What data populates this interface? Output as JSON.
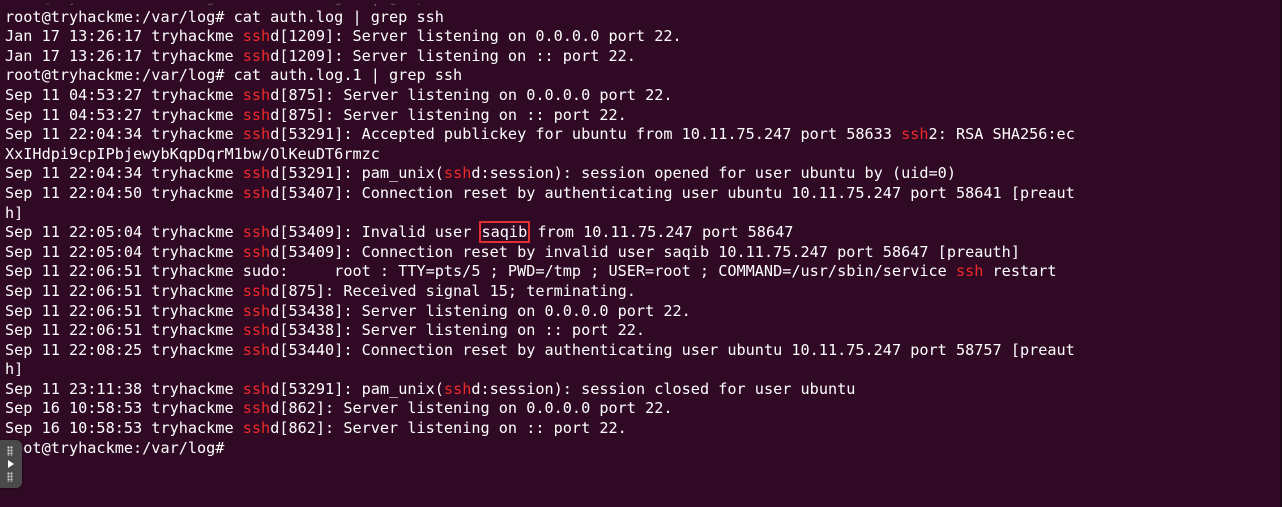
{
  "terminal": {
    "lines": [
      "root@tryhackme:/var/log# cat auth.log.1 | grep ssh ",
      "root@tryhackme:/var/log# cat auth.log | grep ssh",
      "Jan 17 13:26:17 tryhackme sshd[1209]: Server listening on 0.0.0.0 port 22.",
      "Jan 17 13:26:17 tryhackme sshd[1209]: Server listening on :: port 22.",
      "root@tryhackme:/var/log# cat auth.log.1 | grep ssh",
      "Sep 11 04:53:27 tryhackme sshd[875]: Server listening on 0.0.0.0 port 22.",
      "Sep 11 04:53:27 tryhackme sshd[875]: Server listening on :: port 22.",
      "Sep 11 22:04:34 tryhackme sshd[53291]: Accepted publickey for ubuntu from 10.11.75.247 port 58633 ssh2: RSA SHA256:ec",
      "XxIHdpi9cpIPbjewybKqpDqrM1bw/OlKeuDT6rmzc",
      "Sep 11 22:04:34 tryhackme sshd[53291]: pam_unix(sshd:session): session opened for user ubuntu by (uid=0)",
      "Sep 11 22:04:50 tryhackme sshd[53407]: Connection reset by authenticating user ubuntu 10.11.75.247 port 58641 [preaut",
      "h]",
      "Sep 11 22:05:04 tryhackme sshd[53409]: Invalid user saqib from 10.11.75.247 port 58647",
      "Sep 11 22:05:04 tryhackme sshd[53409]: Connection reset by invalid user saqib 10.11.75.247 port 58647 [preauth]",
      "Sep 11 22:06:51 tryhackme sudo:     root : TTY=pts/5 ; PWD=/tmp ; USER=root ; COMMAND=/usr/sbin/service ssh restart",
      "Sep 11 22:06:51 tryhackme sshd[875]: Received signal 15; terminating.",
      "Sep 11 22:06:51 tryhackme sshd[53438]: Server listening on 0.0.0.0 port 22.",
      "Sep 11 22:06:51 tryhackme sshd[53438]: Server listening on :: port 22.",
      "Sep 11 22:08:25 tryhackme sshd[53440]: Connection reset by authenticating user ubuntu 10.11.75.247 port 58757 [preaut",
      "h]",
      "Sep 11 23:11:38 tryhackme sshd[53291]: pam_unix(sshd:session): session closed for user ubuntu",
      "Sep 16 10:58:53 tryhackme sshd[862]: Server listening on 0.0.0.0 port 22.",
      "Sep 16 10:58:53 tryhackme sshd[862]: Server listening on :: port 22.",
      "root@tryhackme:/var/log# "
    ],
    "highlight_term": "ssh",
    "boxed_term": "saqib",
    "boxed_line_index": 12,
    "colors": {
      "background": "#300a24",
      "text": "#ffffff",
      "match": "#ef2929",
      "box": "#e03030"
    }
  }
}
